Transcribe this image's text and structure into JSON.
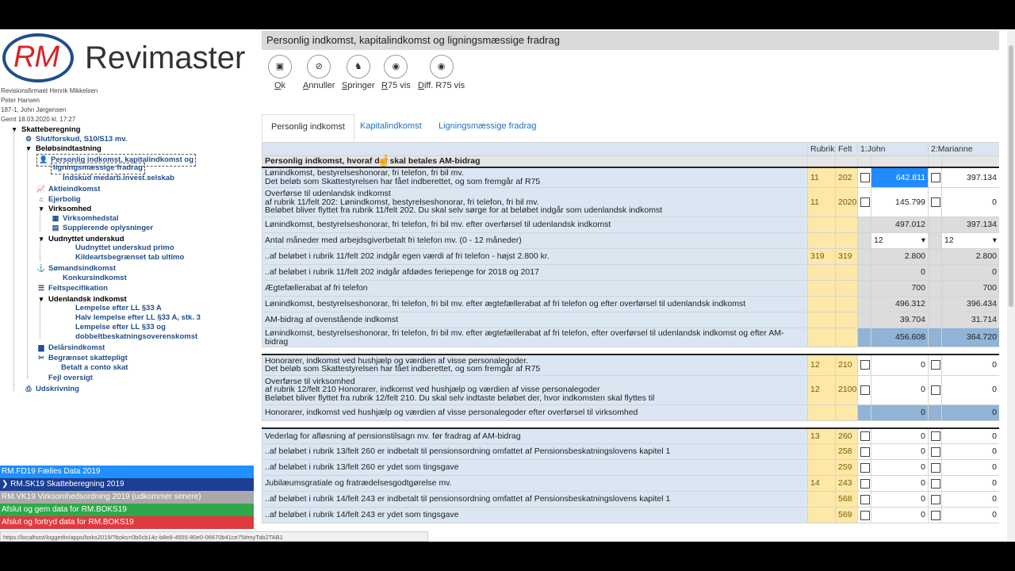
{
  "logo": {
    "mark": "RM",
    "name": "Revimaster"
  },
  "meta": {
    "firm": "Revisionsfirmaet Henrik Mikkelsen",
    "user": "Peter Hansen",
    "client": "187-1, John Jørgensen",
    "saved": "Gemt 18.03.2020 kl. 17:27"
  },
  "tree": [
    {
      "label": "Skatteberegning",
      "black": true,
      "icon": "▾"
    },
    {
      "label": "Slut/forskud, S10/S13 mv.",
      "icon": "⚙"
    },
    {
      "label": "Beløbsindtastning",
      "black": true,
      "icon": "▾"
    },
    {
      "label": "Personlig indkomst, kapitalindkomst og",
      "icon": "👤"
    },
    {
      "label": "ligningsmæssige fradrag",
      "icon": ""
    },
    {
      "label": "Indskud medarb.invest.selskab",
      "icon": ""
    },
    {
      "label": "Aktieindkomst",
      "icon": "📈"
    },
    {
      "label": "Ejerbolig",
      "icon": "⌂"
    },
    {
      "label": "Virksomhed",
      "black": true,
      "icon": "▾"
    },
    {
      "label": "Virksomhedstal",
      "icon": "▦"
    },
    {
      "label": "Supplerende oplysninger",
      "icon": "▤"
    },
    {
      "label": "Uudnyttet underskud",
      "black": true,
      "icon": "▾"
    },
    {
      "label": "Uudnyttet underskud primo",
      "icon": ""
    },
    {
      "label": "Kildeartsbegrænset tab ultimo",
      "icon": ""
    },
    {
      "label": "Sømandsindkomst",
      "icon": "⚓"
    },
    {
      "label": "Konkursindkomst",
      "icon": ""
    },
    {
      "label": "Feltspecifikation",
      "icon": "☰"
    },
    {
      "label": "Udenlandsk indkomst",
      "black": true,
      "icon": "▾"
    },
    {
      "label": "Lempelse efter LL §33 A",
      "icon": ""
    },
    {
      "label": "Halv lempelse efter LL §33 A, stk. 3",
      "icon": ""
    },
    {
      "label": "Lempelse efter LL §33 og",
      "icon": ""
    },
    {
      "label": "dobbeltbeskatningsoverenskomst",
      "icon": ""
    },
    {
      "label": "Delårsindkomst",
      "icon": "▆"
    },
    {
      "label": "Begrænset skattepligt",
      "icon": "✂"
    },
    {
      "label": "Betalt a conto skat",
      "icon": ""
    },
    {
      "label": "Fejl oversigt",
      "icon": ""
    },
    {
      "label": "Udskrivning",
      "icon": "⎙"
    }
  ],
  "bars": [
    {
      "label": "RM.FD19 Fælles Data 2019",
      "color": "#1e90ff"
    },
    {
      "label": "RM.SK19 Skatteberegning 2019",
      "color": "#1c3f94",
      "arrow": "❯"
    },
    {
      "label": "RM.VK19 Virksomhedsordning 2019 (udkommer senere)",
      "color": "#a9a9a9"
    },
    {
      "label": "Afslut og gem data for RM.BOKS19",
      "color": "#2ea84a"
    },
    {
      "label": "Afslut og fortryd data for RM.BOKS19",
      "color": "#e0393e"
    }
  ],
  "status_url": "https://localhost/loggedin/apps/boks2019/?boks=0b0cb14c-b8e8-4555-80e0-06670b41ce75#myTab2TAB1",
  "title": "Personlig indkomst, kapitalindkomst og ligningsmæssige fradrag",
  "toolbar": [
    {
      "label": "Ok",
      "u": "O",
      "rest": "k",
      "icon": "▣"
    },
    {
      "label": "Annuller",
      "u": "A",
      "rest": "nnuller",
      "icon": "⊘"
    },
    {
      "label": "Springer",
      "u": "S",
      "rest": "pringer",
      "icon": "♞"
    },
    {
      "label": "R75 vis",
      "u": "R",
      "rest": "75 vis",
      "icon": "◉"
    },
    {
      "label": "Diff. R75 vis",
      "u": "D",
      "rest": "iff. R75 vis",
      "icon": "◉"
    }
  ],
  "tabs": [
    "Personlig indkomst",
    "Kapitalindkomst",
    "Ligningsmæssige fradrag"
  ],
  "columns": {
    "rubrik": "Rubrik",
    "felt": "Felt",
    "p1": "1:John",
    "p2": "2:Marianne"
  },
  "section_title": "Personlig indkomst, hvoraf der skal betales AM-bidrag",
  "rows": [
    {
      "text": "Lønindkomst, bestyrelseshonorar, fri telefon, fri bil mv.\nDet beløb som Skattestyrelsen har fået indberettet, og som fremgår af R75",
      "rubrik": "11",
      "felt": "202",
      "cb1": true,
      "v1": "642.811",
      "cb2": true,
      "v2": "397.134",
      "style": "sel-first",
      "sect": true
    },
    {
      "text": "Overførse til udenlandsk indkomst\naf rubrik 11/felt 202: Lønindkomst, bestyrelseshonorar, fri telefon, fri bil mv.\nBeløbet bliver flyttet fra rubrik 11/felt 202. Du skal selv sørge for at beløbet indgår som udenlandsk indkomst",
      "rubrik": "11",
      "felt": "2020",
      "cb1": true,
      "v1": "145.799",
      "cb2": true,
      "v2": "0",
      "style": "white"
    },
    {
      "text": "Lønindkomst, bestyrelseshonorar, fri telefon, fri bil mv. efter overførsel til udenlandsk indkomst",
      "rubrik": "",
      "felt": "",
      "v1": "497.012",
      "v2": "397.134",
      "style": "gray"
    },
    {
      "text": "Antal måneder med arbejdsgiverbetalt fri telefon mv. (0 - 12 måneder)",
      "rubrik": "",
      "felt": "",
      "v1": "12",
      "v2": "12",
      "style": "select"
    },
    {
      "text": "..af beløbet i rubrik 11/felt 202 indgår egen værdi af fri telefon - højst 2.800 kr.",
      "rubrik": "319",
      "felt": "319",
      "v1": "2.800",
      "v2": "2.800",
      "style": "gray"
    },
    {
      "text": "..af beløbet i rubrik 11/felt 202 indgår afdødes feriepenge for 2018 og 2017",
      "rubrik": "",
      "felt": "",
      "v1": "0",
      "v2": "0",
      "style": "gray"
    },
    {
      "text": "Ægtefællerabat af fri telefon",
      "rubrik": "",
      "felt": "",
      "v1": "700",
      "v2": "700",
      "style": "gray"
    },
    {
      "text": "Lønindkomst, bestyrelseshonorar, fri telefon, fri bil mv. efter ægtefællerabat af fri telefon og efter overførsel til udenlandsk indkomst",
      "rubrik": "",
      "felt": "",
      "v1": "496.312",
      "v2": "396.434",
      "style": "gray"
    },
    {
      "text": "AM-bidrag af ovenstående indkomst",
      "rubrik": "",
      "felt": "",
      "v1": "39.704",
      "v2": "31.714",
      "style": "gray"
    },
    {
      "text": "Lønindkomst, bestyrelseshonorar, fri telefon, fri bil mv. efter ægtefællerabat af fri telefon, efter overførsel til udenlandsk indkomst og efter AM-bidrag",
      "rubrik": "",
      "felt": "",
      "v1": "456.608",
      "v2": "364.720",
      "style": "blue"
    },
    {
      "spacer": true
    },
    {
      "text": "Honorarer, indkomst ved hushjælp og værdien af visse personalegoder.\nDet beløb som Skattestyrelsen har fået indberettet, og som fremgår af R75",
      "rubrik": "12",
      "felt": "210",
      "cb1": true,
      "v1": "0",
      "cb2": true,
      "v2": "0",
      "style": "white",
      "sect": true
    },
    {
      "text": "Overførse til virksomhed\naf rubrik 12/felt 210 Honorarer, indkomst ved hushjælp og værdien af visse personalegoder\nBeløbet bliver flyttet fra rubrik 12/felt 210. Du skal selv indtaste beløbet der, hvor indkomsten skal flyttes til",
      "rubrik": "12",
      "felt": "2100",
      "cb1": true,
      "v1": "0",
      "cb2": true,
      "v2": "0",
      "style": "white"
    },
    {
      "text": "Honorarer, indkomst ved hushjælp og værdien af visse personalegoder efter overførsel til virksomhed",
      "rubrik": "",
      "felt": "",
      "v1": "0",
      "v2": "0",
      "style": "blue"
    },
    {
      "spacer": true
    },
    {
      "text": "Vederlag for afløsning af pensionstilsagn mv. før fradrag af AM-bidrag",
      "rubrik": "13",
      "felt": "260",
      "cb1": true,
      "v1": "0",
      "cb2": true,
      "v2": "0",
      "style": "white",
      "sect": true
    },
    {
      "text": "..af beløbet i rubrik 13/felt 260 er indbetalt til pensionsordning omfattet af Pensionsbeskatningslovens kapitel 1",
      "rubrik": "",
      "felt": "258",
      "cb1": true,
      "v1": "0",
      "cb2": true,
      "v2": "0",
      "style": "white"
    },
    {
      "text": "..af beløbet i rubrik 13/felt 260 er ydet som tingsgave",
      "rubrik": "",
      "felt": "259",
      "cb1": true,
      "v1": "0",
      "cb2": true,
      "v2": "0",
      "style": "white"
    },
    {
      "text": "Jubilæumsgratiale og fratrædelsesgodtgørelse mv.",
      "rubrik": "14",
      "felt": "243",
      "cb1": true,
      "v1": "0",
      "cb2": true,
      "v2": "0",
      "style": "white"
    },
    {
      "text": "..af beløbet i rubrik 14/felt 243 er indbetalt til pensionsordning omfattet af Pensionsbeskatningslovens kapitel 1",
      "rubrik": "",
      "felt": "568",
      "cb1": true,
      "v1": "0",
      "cb2": true,
      "v2": "0",
      "style": "white"
    },
    {
      "text": "..af beløbet i rubrik 14/felt 243 er ydet som tingsgave",
      "rubrik": "",
      "felt": "569",
      "cb1": true,
      "v1": "0",
      "cb2": true,
      "v2": "0",
      "style": "white"
    }
  ]
}
